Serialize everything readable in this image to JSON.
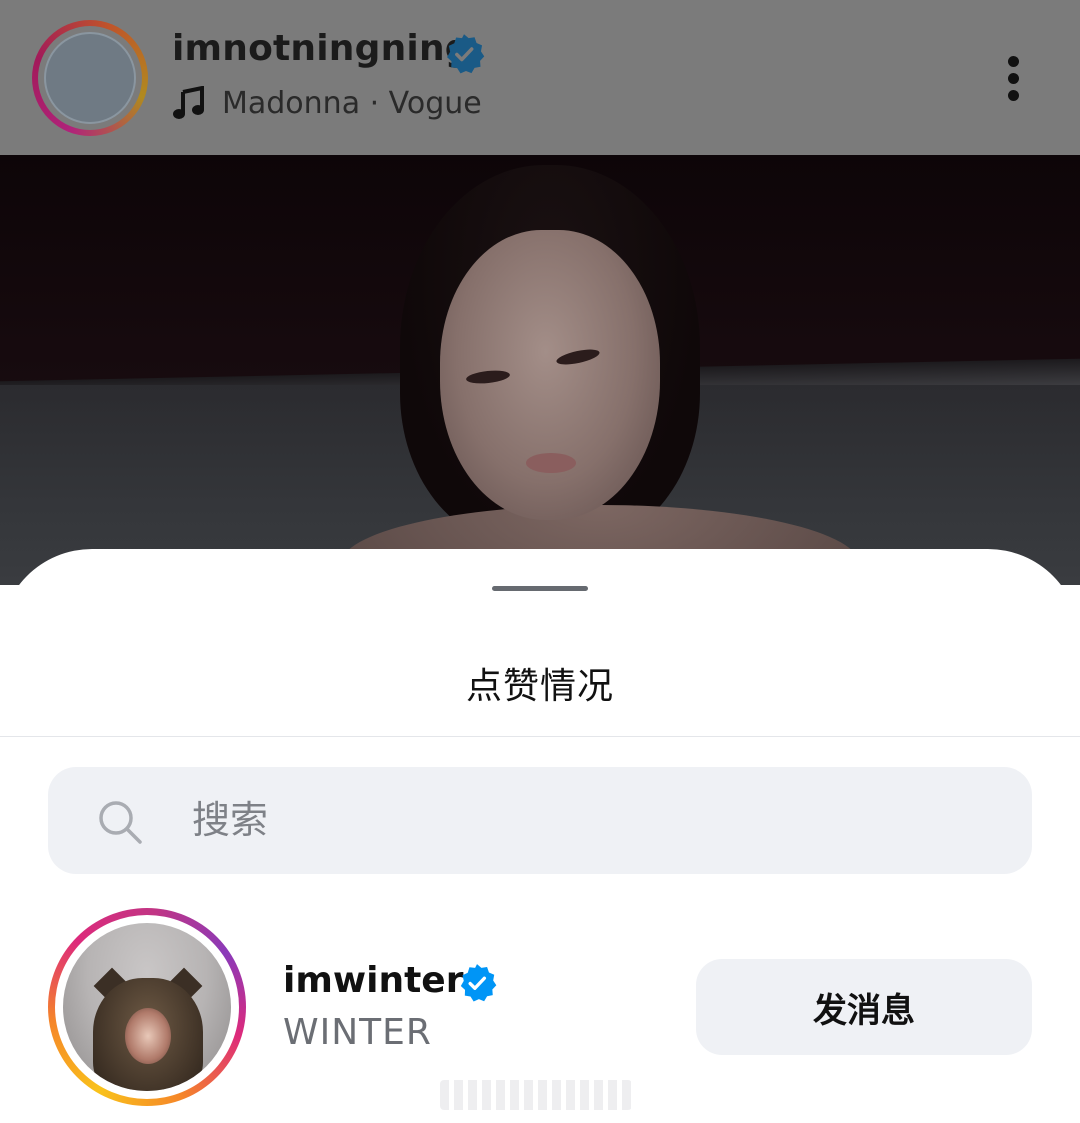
{
  "post": {
    "username": "imnotningning",
    "music": "Madonna · Vogue",
    "verified": true
  },
  "sheet": {
    "title": "点赞情况",
    "search_placeholder": "搜索"
  },
  "likers": [
    {
      "username": "imwinter",
      "full_name": "WINTER",
      "verified": true,
      "action_label": "发消息"
    }
  ],
  "colors": {
    "verified_blue": "#0095f6",
    "story_ring": [
      "#f9c21b",
      "#f58529",
      "#dd2a7b",
      "#c13584",
      "#8a3ab9"
    ]
  }
}
